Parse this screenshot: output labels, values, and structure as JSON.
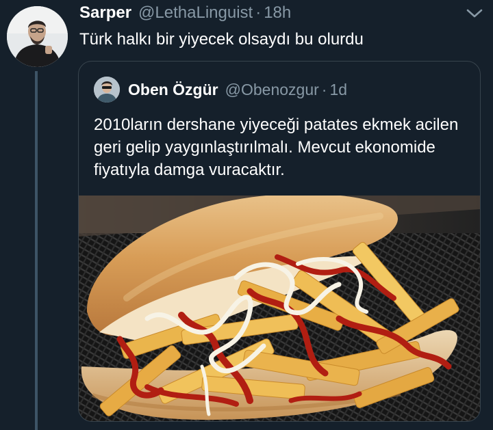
{
  "tweet": {
    "display_name": "Sarper",
    "handle": "@LethaLinguist",
    "separator": "·",
    "time": "18h",
    "text": "Türk halkı bir yiyecek olsaydı bu olurdu"
  },
  "quoted_tweet": {
    "display_name": "Oben Özgür",
    "handle": "@Obenozgur",
    "separator": "·",
    "time": "1d",
    "text": "2010ların dershane yiyeceği patates ekmek acilen geri gelip yaygınlaştırılmalı. Mevcut ekonomide fiyatıyla damga vuracaktır.",
    "media": "photo of a bread roll filled with french fries, ketchup and mayonnaise"
  },
  "colors": {
    "background": "#15202b",
    "secondary_text": "#8899a6",
    "border": "#38444d",
    "thread_line": "#3d5466"
  },
  "icons": {
    "menu": "chevron-down-icon"
  }
}
